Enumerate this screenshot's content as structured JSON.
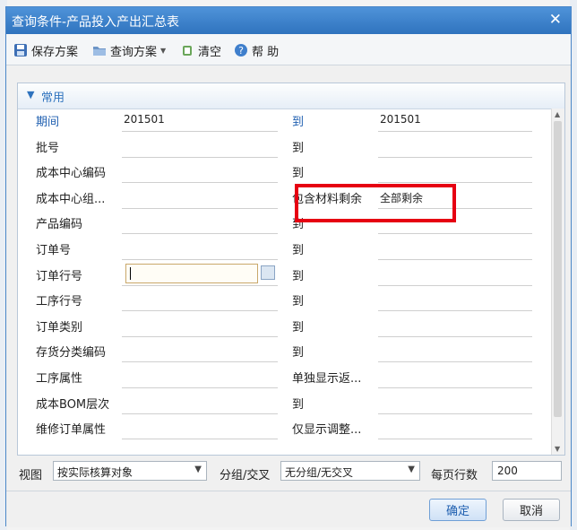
{
  "window": {
    "title": "查询条件-产品投入产出汇总表"
  },
  "toolbar": {
    "save_plan": "保存方案",
    "query_plan": "查询方案",
    "clear": "清空",
    "help": "帮 助"
  },
  "panel": {
    "title": "常用"
  },
  "rows": [
    {
      "left_label": "期间",
      "left_value": "201501",
      "right_label": "到",
      "right_value": "201501",
      "highlight": true
    },
    {
      "left_label": "批号",
      "left_value": "",
      "right_label": "到",
      "right_value": "",
      "highlight": false
    },
    {
      "left_label": "成本中心编码",
      "left_value": "",
      "right_label": "到",
      "right_value": "",
      "highlight": false
    },
    {
      "left_label": "成本中心组...",
      "left_value": "",
      "right_label": "包含材料剩余",
      "right_value": "全部剩余",
      "highlight": false
    },
    {
      "left_label": "产品编码",
      "left_value": "",
      "right_label": "到",
      "right_value": "",
      "highlight": false
    },
    {
      "left_label": "订单号",
      "left_value": "",
      "right_label": "到",
      "right_value": "",
      "highlight": false
    },
    {
      "left_label": "订单行号",
      "left_value": "",
      "right_label": "到",
      "right_value": "",
      "highlight": false
    },
    {
      "left_label": "工序行号",
      "left_value": "",
      "right_label": "到",
      "right_value": "",
      "highlight": false
    },
    {
      "left_label": "订单类别",
      "left_value": "",
      "right_label": "到",
      "right_value": "",
      "highlight": false
    },
    {
      "left_label": "存货分类编码",
      "left_value": "",
      "right_label": "到",
      "right_value": "",
      "highlight": false
    },
    {
      "left_label": "工序属性",
      "left_value": "",
      "right_label": "单独显示返...",
      "right_value": "",
      "highlight": false
    },
    {
      "left_label": "成本BOM层次",
      "left_value": "",
      "right_label": "到",
      "right_value": "",
      "highlight": false
    },
    {
      "left_label": "维修订单属性",
      "left_value": "",
      "right_label": "仅显示调整...",
      "right_value": "",
      "highlight": false
    }
  ],
  "bottom": {
    "view_label": "视图",
    "view_value": "按实际核算对象",
    "group_label": "分组/交叉",
    "group_value": "无分组/无交叉",
    "rows_label": "每页行数",
    "rows_value": "200"
  },
  "footer": {
    "ok": "确定",
    "cancel": "取消"
  },
  "colors": {
    "title_bar": "#2f73be",
    "accent": "#1f5fb0",
    "highlight_box": "#e60012"
  }
}
